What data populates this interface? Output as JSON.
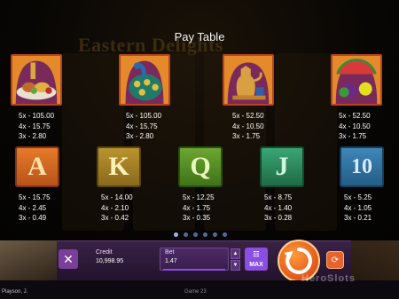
{
  "paytable": {
    "title": "Pay Table",
    "premium": [
      {
        "id": "feast",
        "pays": [
          "5x - 105.00",
          "4x - 15.75",
          "3x - 2.80"
        ]
      },
      {
        "id": "peacock",
        "pays": [
          "5x - 105.00",
          "4x - 15.75",
          "3x - 2.80"
        ]
      },
      {
        "id": "teapot",
        "pays": [
          "5x - 52.50",
          "4x - 10.50",
          "3x - 1.75"
        ]
      },
      {
        "id": "fruits",
        "pays": [
          "5x - 52.50",
          "4x - 10.50",
          "3x - 1.75"
        ]
      }
    ],
    "royals": [
      {
        "letter": "A",
        "pays": [
          "5x - 15.75",
          "4x - 2.45",
          "3x - 0.49"
        ]
      },
      {
        "letter": "K",
        "pays": [
          "5x - 14.00",
          "4x - 2.10",
          "3x - 0.42"
        ]
      },
      {
        "letter": "Q",
        "pays": [
          "5x - 12.25",
          "4x - 1.75",
          "3x - 0.35"
        ]
      },
      {
        "letter": "J",
        "pays": [
          "5x - 8.75",
          "4x - 1.40",
          "3x - 0.28"
        ]
      },
      {
        "letter": "10",
        "pays": [
          "5x - 5.25",
          "4x - 1.05",
          "3x - 0.21"
        ]
      }
    ],
    "pages": 6,
    "current_page": 1
  },
  "background": {
    "logo_text": "Eastern Delights"
  },
  "controls": {
    "close_icon": "close-icon",
    "credit_label": "Credit",
    "credit_value": "10,998.95",
    "bet_label": "Bet",
    "bet_value": "1.47",
    "max_label": "MAX",
    "spin_icon": "spin-icon",
    "autoplay_icon": "autoplay-icon"
  },
  "footer": {
    "left_text": "Playson, J.",
    "mid_text": "Game 23"
  },
  "watermark": "HeroSlots",
  "colors": {
    "accent": "#8a4fe0",
    "spin": "#e8621e",
    "bar": "#2e1a3a"
  }
}
